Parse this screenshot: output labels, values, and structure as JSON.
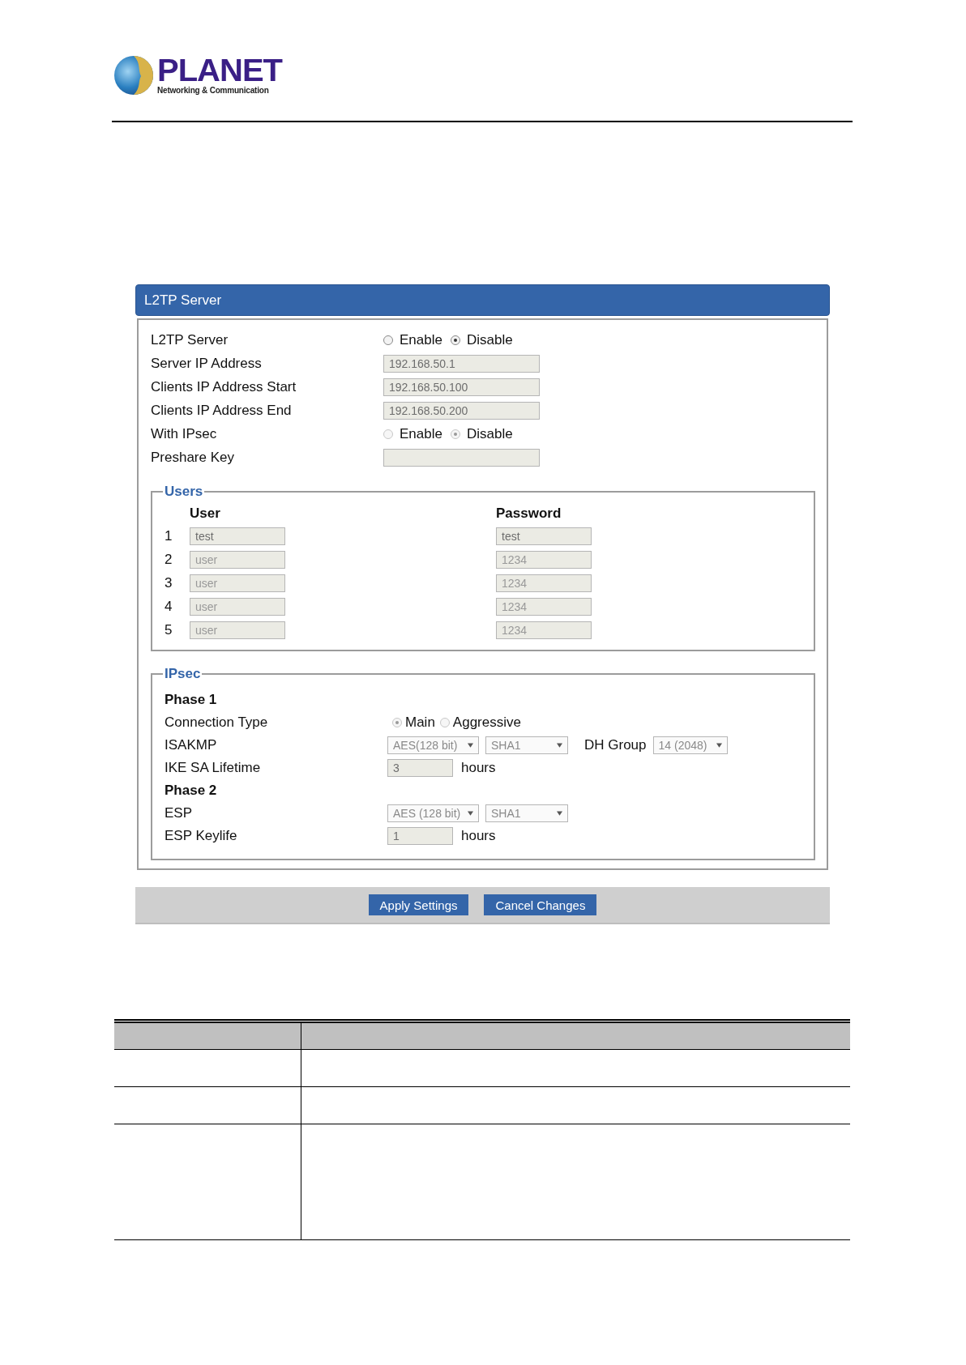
{
  "logo": {
    "name": "PLANET",
    "tagline": "Networking & Communication"
  },
  "panel": {
    "title": "L2TP Server",
    "settings": [
      {
        "kind": "radio",
        "label": "L2TP Server",
        "disabled": false,
        "options": [
          {
            "label": "Enable",
            "selected": false
          },
          {
            "label": "Disable",
            "selected": true
          }
        ]
      },
      {
        "kind": "field",
        "label": "Server IP Address",
        "value": "192.168.50.1"
      },
      {
        "kind": "field",
        "label": "Clients IP Address Start",
        "value": "192.168.50.100"
      },
      {
        "kind": "field",
        "label": "Clients IP Address End",
        "value": "192.168.50.200"
      },
      {
        "kind": "radio",
        "label": "With IPsec",
        "disabled": true,
        "options": [
          {
            "label": "Enable",
            "selected": false
          },
          {
            "label": "Disable",
            "selected": true
          }
        ]
      },
      {
        "kind": "field",
        "label": "Preshare Key"
      }
    ],
    "users": {
      "title": "Users",
      "columns": [
        "User",
        "Password"
      ],
      "rows": [
        {
          "index": "1",
          "user": "test",
          "password": "test"
        },
        {
          "index": "2",
          "user": "user",
          "password": "1234"
        },
        {
          "index": "3",
          "user": "user",
          "password": "1234"
        },
        {
          "index": "4",
          "user": "user",
          "password": "1234"
        },
        {
          "index": "5",
          "user": "user",
          "password": "1234"
        }
      ]
    },
    "ipsec": {
      "title": "IPsec",
      "rows": [
        {
          "kind": "heading",
          "label": "Phase 1"
        },
        {
          "kind": "radio",
          "label": "Connection Type",
          "disabled": true,
          "options": [
            {
              "label": "Main",
              "selected": true
            },
            {
              "label": "Aggressive",
              "selected": false
            }
          ]
        },
        {
          "kind": "selects",
          "label": "ISAKMP",
          "selects": [
            "AES(128 bit)",
            "SHA1"
          ],
          "extra_label": "DH Group",
          "extra_select": "14 (2048)"
        },
        {
          "kind": "number",
          "label": "IKE SA Lifetime",
          "value": "3",
          "unit": "hours"
        },
        {
          "kind": "heading",
          "label": "Phase 2"
        },
        {
          "kind": "selects",
          "label": "ESP",
          "selects": [
            "AES (128 bit)",
            "SHA1"
          ]
        },
        {
          "kind": "number",
          "label": "ESP Keylife",
          "value": "1",
          "unit": "hours"
        }
      ]
    },
    "buttons": [
      "Apply Settings",
      "Cancel Changes"
    ]
  }
}
